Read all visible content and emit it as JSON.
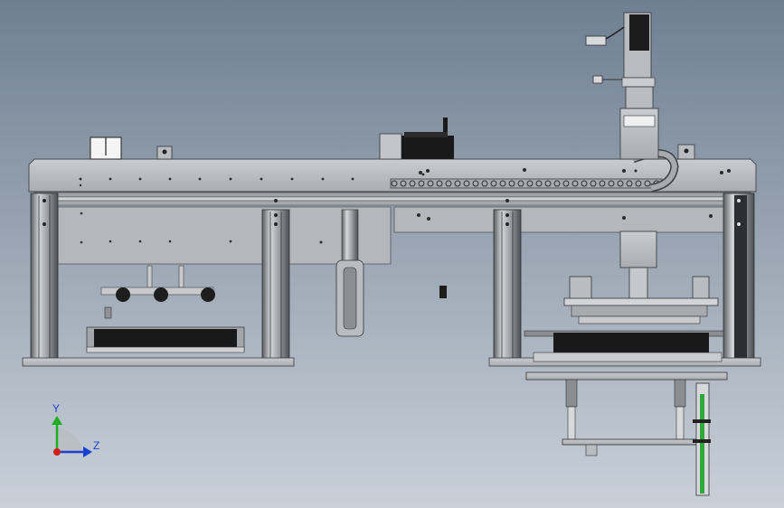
{
  "viewport": {
    "background_top": "#6f7f92",
    "background_bottom": "#c9d0d8",
    "metal_color": "#b9bcc0",
    "metal_dark": "#8a8d91",
    "block_color": "#1c1c1c"
  },
  "triad": {
    "y_label": "Y",
    "z_label": "Z",
    "y_color": "#1fae1f",
    "z_color": "#1b3fd1",
    "origin_color": "#d01c1c"
  }
}
